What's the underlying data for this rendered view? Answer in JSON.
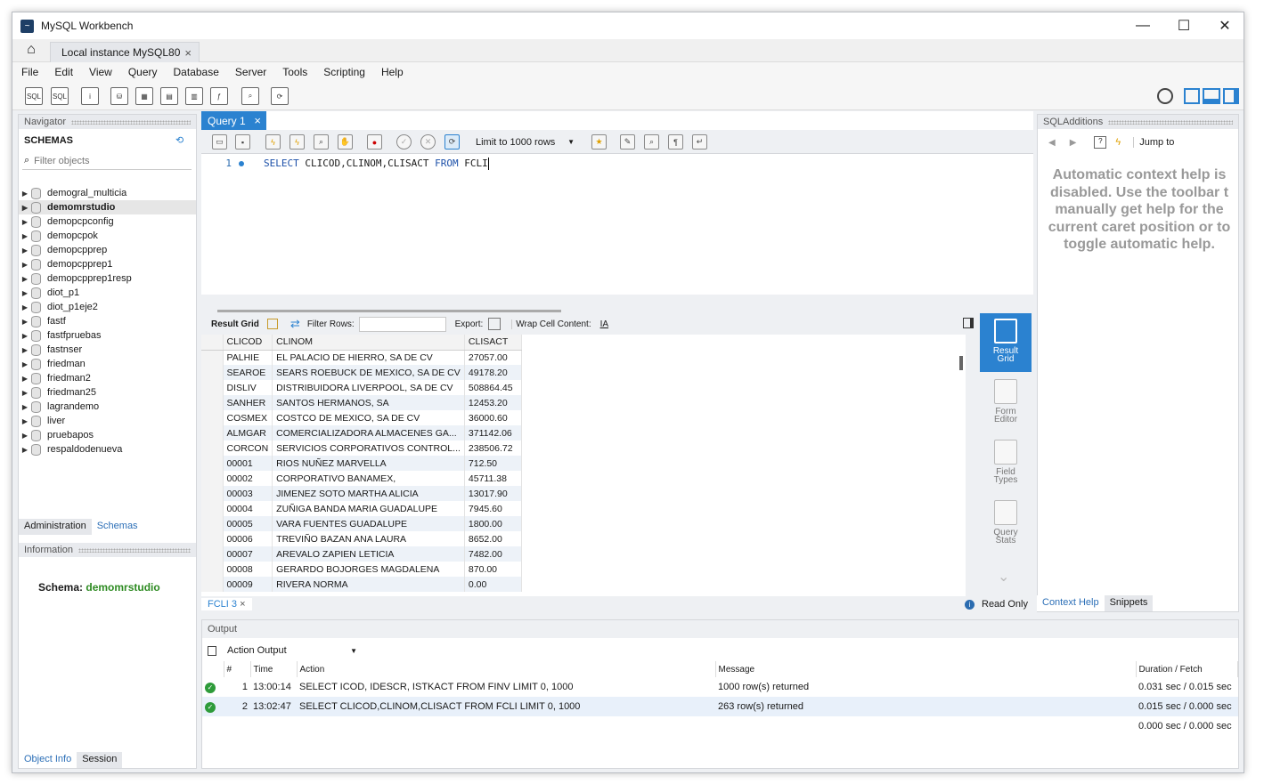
{
  "window": {
    "title": "MySQL Workbench",
    "minimize": "—",
    "maximize": "☐",
    "close": "✕"
  },
  "connection_tab": {
    "label": "Local instance MySQL80",
    "close": "×"
  },
  "menu": [
    "File",
    "Edit",
    "View",
    "Query",
    "Database",
    "Server",
    "Tools",
    "Scripting",
    "Help"
  ],
  "navigator": {
    "title": "Navigator",
    "schemas_label": "SCHEMAS",
    "filter_placeholder": "Filter objects",
    "schemas": [
      "demogral_multicia",
      "demomrstudio",
      "demopcpconfig",
      "demopcpok",
      "demopcpprep",
      "demopcpprep1",
      "demopcpprep1resp",
      "diot_p1",
      "diot_p1eje2",
      "fastf",
      "fastfpruebas",
      "fastnser",
      "friedman",
      "friedman2",
      "friedman25",
      "lagrandemo",
      "liver",
      "pruebapos",
      "respaldodenueva"
    ],
    "selected_schema": "demomrstudio",
    "tabs": [
      "Administration",
      "Schemas"
    ],
    "active_tab": "Schemas",
    "info_title": "Information",
    "schema_label": "Schema:",
    "schema_value": "demomrstudio",
    "bottom_tabs": [
      "Object Info",
      "Session"
    ]
  },
  "editor": {
    "tab_label": "Query 1",
    "tab_close": "×",
    "limit_label": "Limit to 1000 rows",
    "line_number": "1",
    "sql": {
      "select": "SELECT",
      "columns": "CLICOD,CLINOM,CLISACT",
      "from": "FROM",
      "table": "FCLI"
    }
  },
  "result": {
    "toolbar": {
      "grid_label": "Result Grid",
      "filter_label": "Filter Rows:",
      "export_label": "Export:",
      "wrap_label": "Wrap Cell Content:"
    },
    "columns": [
      "CLICOD",
      "CLINOM",
      "CLISACT"
    ],
    "rows": [
      [
        "PALHIE",
        "EL PALACIO DE HIERRO, SA DE CV",
        "27057.00"
      ],
      [
        "SEAROE",
        "SEARS ROEBUCK DE MEXICO, SA DE CV",
        "49178.20"
      ],
      [
        "DISLIV",
        "DISTRIBUIDORA LIVERPOOL, SA DE CV",
        "508864.45"
      ],
      [
        "SANHER",
        "SANTOS HERMANOS, SA",
        "12453.20"
      ],
      [
        "COSMEX",
        "COSTCO DE MEXICO, SA DE CV",
        "36000.60"
      ],
      [
        "ALMGAR",
        "COMERCIALIZADORA ALMACENES GA...",
        "371142.06"
      ],
      [
        "CORCON",
        "SERVICIOS CORPORATIVOS CONTROL...",
        "238506.72"
      ],
      [
        "00001",
        "RIOS NUÑEZ MARVELLA",
        "712.50"
      ],
      [
        "00002",
        "CORPORATIVO BANAMEX,",
        "45711.38"
      ],
      [
        "00003",
        "JIMENEZ SOTO MARTHA ALICIA",
        "13017.90"
      ],
      [
        "00004",
        "ZUÑIGA BANDA MARIA GUADALUPE",
        "7945.60"
      ],
      [
        "00005",
        "VARA FUENTES GUADALUPE",
        "1800.00"
      ],
      [
        "00006",
        "TREVIÑO BAZAN ANA LAURA",
        "8652.00"
      ],
      [
        "00007",
        "AREVALO ZAPIEN LETICIA",
        "7482.00"
      ],
      [
        "00008",
        "GERARDO BOJORGES MAGDALENA",
        "870.00"
      ],
      [
        "00009",
        "RIVERA NORMA",
        "0.00"
      ]
    ],
    "side_buttons": [
      [
        "Result",
        "Grid"
      ],
      [
        "Form",
        "Editor"
      ],
      [
        "Field",
        "Types"
      ],
      [
        "Query",
        "Stats"
      ]
    ],
    "bottom_tab": "FCLI 3",
    "read_only": "Read Only"
  },
  "sql_additions": {
    "title": "SQLAdditions",
    "jump_label": "Jump to",
    "help_text": "Automatic context help is disabled. Use the toolbar t manually get help for the current caret position or to toggle automatic help.",
    "tabs": [
      "Context Help",
      "Snippets"
    ]
  },
  "output": {
    "title": "Output",
    "dropdown": "Action Output",
    "columns": [
      "#",
      "Time",
      "Action",
      "Message",
      "Duration / Fetch"
    ],
    "rows": [
      {
        "num": "1",
        "time": "13:00:14",
        "action": "SELECT ICOD, IDESCR, ISTKACT FROM FINV LIMIT 0, 1000",
        "message": "1000 row(s) returned",
        "duration": "0.031 sec / 0.015 sec"
      },
      {
        "num": "2",
        "time": "13:02:47",
        "action": "SELECT CLICOD,CLINOM,CLISACT FROM FCLI LIMIT 0, 1000",
        "message": "263 row(s) returned",
        "duration": "0.015 sec / 0.000 sec"
      }
    ],
    "extra_duration": "0.000 sec / 0.000 sec"
  },
  "colors": {
    "accent": "#2b82d0",
    "schema_green": "#2e8b22",
    "ok_green": "#2e9b3a"
  }
}
